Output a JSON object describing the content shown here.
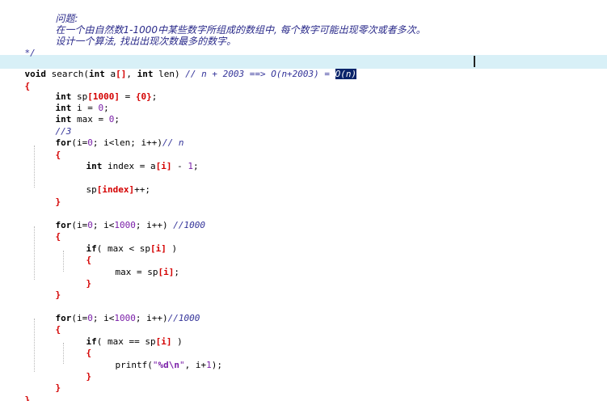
{
  "comment": {
    "label_problem": "问题:",
    "problem_line1": "在一个由自然数1-1000中某些数字所组成的数组中, 每个数字可能出现零次或者多次。",
    "problem_line2": "设计一个算法, 找出出现次数最多的数字。",
    "close": "*/"
  },
  "code": {
    "sig_kw1": "void",
    "sig_fn": " search(",
    "sig_kw2": "int",
    "sig_param1": " a",
    "sig_brk": "[]",
    "sig_comma": ", ",
    "sig_kw3": "int",
    "sig_param2": " len)",
    "sig_comment": " // n + 2003 ==> O(n+2003) = ",
    "sig_selected": "O(n)",
    "open_brace": "{",
    "l1_kw": "int",
    "l1_a": " sp",
    "l1_b": "[1000]",
    "l1_c": " = ",
    "l1_d": "{0}",
    "l1_e": ";",
    "l2_kw": "int",
    "l2_a": " i = ",
    "l2_n": "0",
    "l2_e": ";",
    "l3_kw": "int",
    "l3_a": " max = ",
    "l3_n": "0",
    "l3_e": ";",
    "l4_cm": "//3",
    "for1_kw": "for",
    "for1_a": "(i=",
    "for1_n": "0",
    "for1_b": "; i<len; i++)",
    "for1_cm": "// n",
    "for1_open": "{",
    "idx_kw": "int",
    "idx_a": " index = a",
    "idx_b": "[i]",
    "idx_c": " - ",
    "idx_n": "1",
    "idx_e": ";",
    "inc_a": "sp",
    "inc_b": "[index]",
    "inc_c": "++;",
    "for1_close": "}",
    "for2_kw": "for",
    "for2_a": "(i=",
    "for2_n1": "0",
    "for2_b": "; i<",
    "for2_n2": "1000",
    "for2_c": "; i++) ",
    "for2_cm": "//1000",
    "for2_open": "{",
    "if1_kw": "if",
    "if1_a": "( max < sp",
    "if1_b": "[i]",
    "if1_c": " )",
    "if1_open": "{",
    "asg_a": "max = sp",
    "asg_b": "[i]",
    "asg_c": ";",
    "if1_close": "}",
    "for2_close": "}",
    "for3_kw": "for",
    "for3_a": "(i=",
    "for3_n1": "0",
    "for3_b": "; i<",
    "for3_n2": "1000",
    "for3_c": "; i++)",
    "for3_cm": "//1000",
    "for3_open": "{",
    "if2_kw": "if",
    "if2_a": "( max == sp",
    "if2_b": "[i]",
    "if2_c": " )",
    "if2_open": "{",
    "pf_a": "printf(",
    "pf_s1": "\"",
    "pf_fmt": "%d\\n",
    "pf_s2": "\"",
    "pf_b": ", i+",
    "pf_n": "1",
    "pf_c": ");",
    "if2_close": "}",
    "for3_close": "}",
    "close_brace": "}"
  },
  "colors": {
    "keyword": "#000000",
    "comment": "#333399",
    "number": "#7a1fa8",
    "bracket": "#d40000",
    "selection": "#0a246a",
    "current_line": "#d8f0f7"
  }
}
